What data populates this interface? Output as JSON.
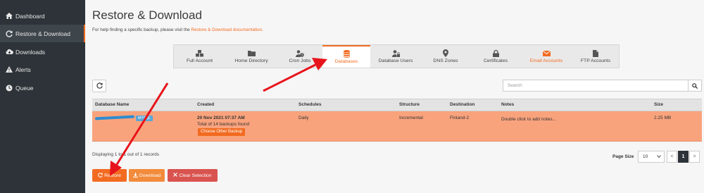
{
  "sidebar": {
    "items": [
      {
        "label": "Dashboard",
        "icon": "home-icon"
      },
      {
        "label": "Restore & Download",
        "icon": "refresh-icon",
        "active": true
      },
      {
        "label": "Downloads",
        "icon": "cloud-download-icon"
      },
      {
        "label": "Alerts",
        "icon": "warning-icon"
      },
      {
        "label": "Queue",
        "icon": "clock-icon"
      }
    ]
  },
  "header": {
    "title": "Restore & Download",
    "help_prefix": "For help finding a specific backup, please visit the ",
    "help_link": "Restore & Download documentation."
  },
  "tabs": [
    {
      "label": "Full Account",
      "icon": "cubes-icon"
    },
    {
      "label": "Home Directory",
      "icon": "folder-icon"
    },
    {
      "label": "Cron Jobs",
      "icon": "user-clock-icon"
    },
    {
      "label": "Databases",
      "icon": "database-icon",
      "active": true
    },
    {
      "label": "Database Users",
      "icon": "user-lock-icon"
    },
    {
      "label": "DNS Zones",
      "icon": "map-marker-icon"
    },
    {
      "label": "Certificates",
      "icon": "lock-icon"
    },
    {
      "label": "Email Accounts",
      "icon": "envelope-icon"
    },
    {
      "label": "FTP Accounts",
      "icon": "file-icon"
    }
  ],
  "search": {
    "placeholder": "Search"
  },
  "table": {
    "headers": [
      "Database Name",
      "Created",
      "Schedules",
      "Structure",
      "Destination",
      "Notes",
      "Size"
    ],
    "rows": [
      {
        "db_badge": "MYSQL",
        "created_date": "20 Nov 2021 07:37 AM",
        "created_sub": "Total of 14 backups found",
        "choose_label": "Choose Other Backup",
        "schedule": "Daily",
        "structure": "Incremental",
        "destination": "Finland-2",
        "notes": "Double click to add notes...",
        "size": "2.25 MB"
      }
    ]
  },
  "footer": {
    "display_info": "Displaying 1 to 1 out of 1 records",
    "page_size_label": "Page Size",
    "page_size_value": "10",
    "pagination": [
      "<",
      "1",
      ">"
    ]
  },
  "actions": {
    "restore": "Restore",
    "download": "Download",
    "clear": "Clear Selection"
  },
  "colors": {
    "accent": "#f26b21",
    "sidebar_bg": "#2d3338",
    "selected_row": "#f9a37d",
    "danger": "#d9534f",
    "annotation_arrow": "#e8141b"
  }
}
